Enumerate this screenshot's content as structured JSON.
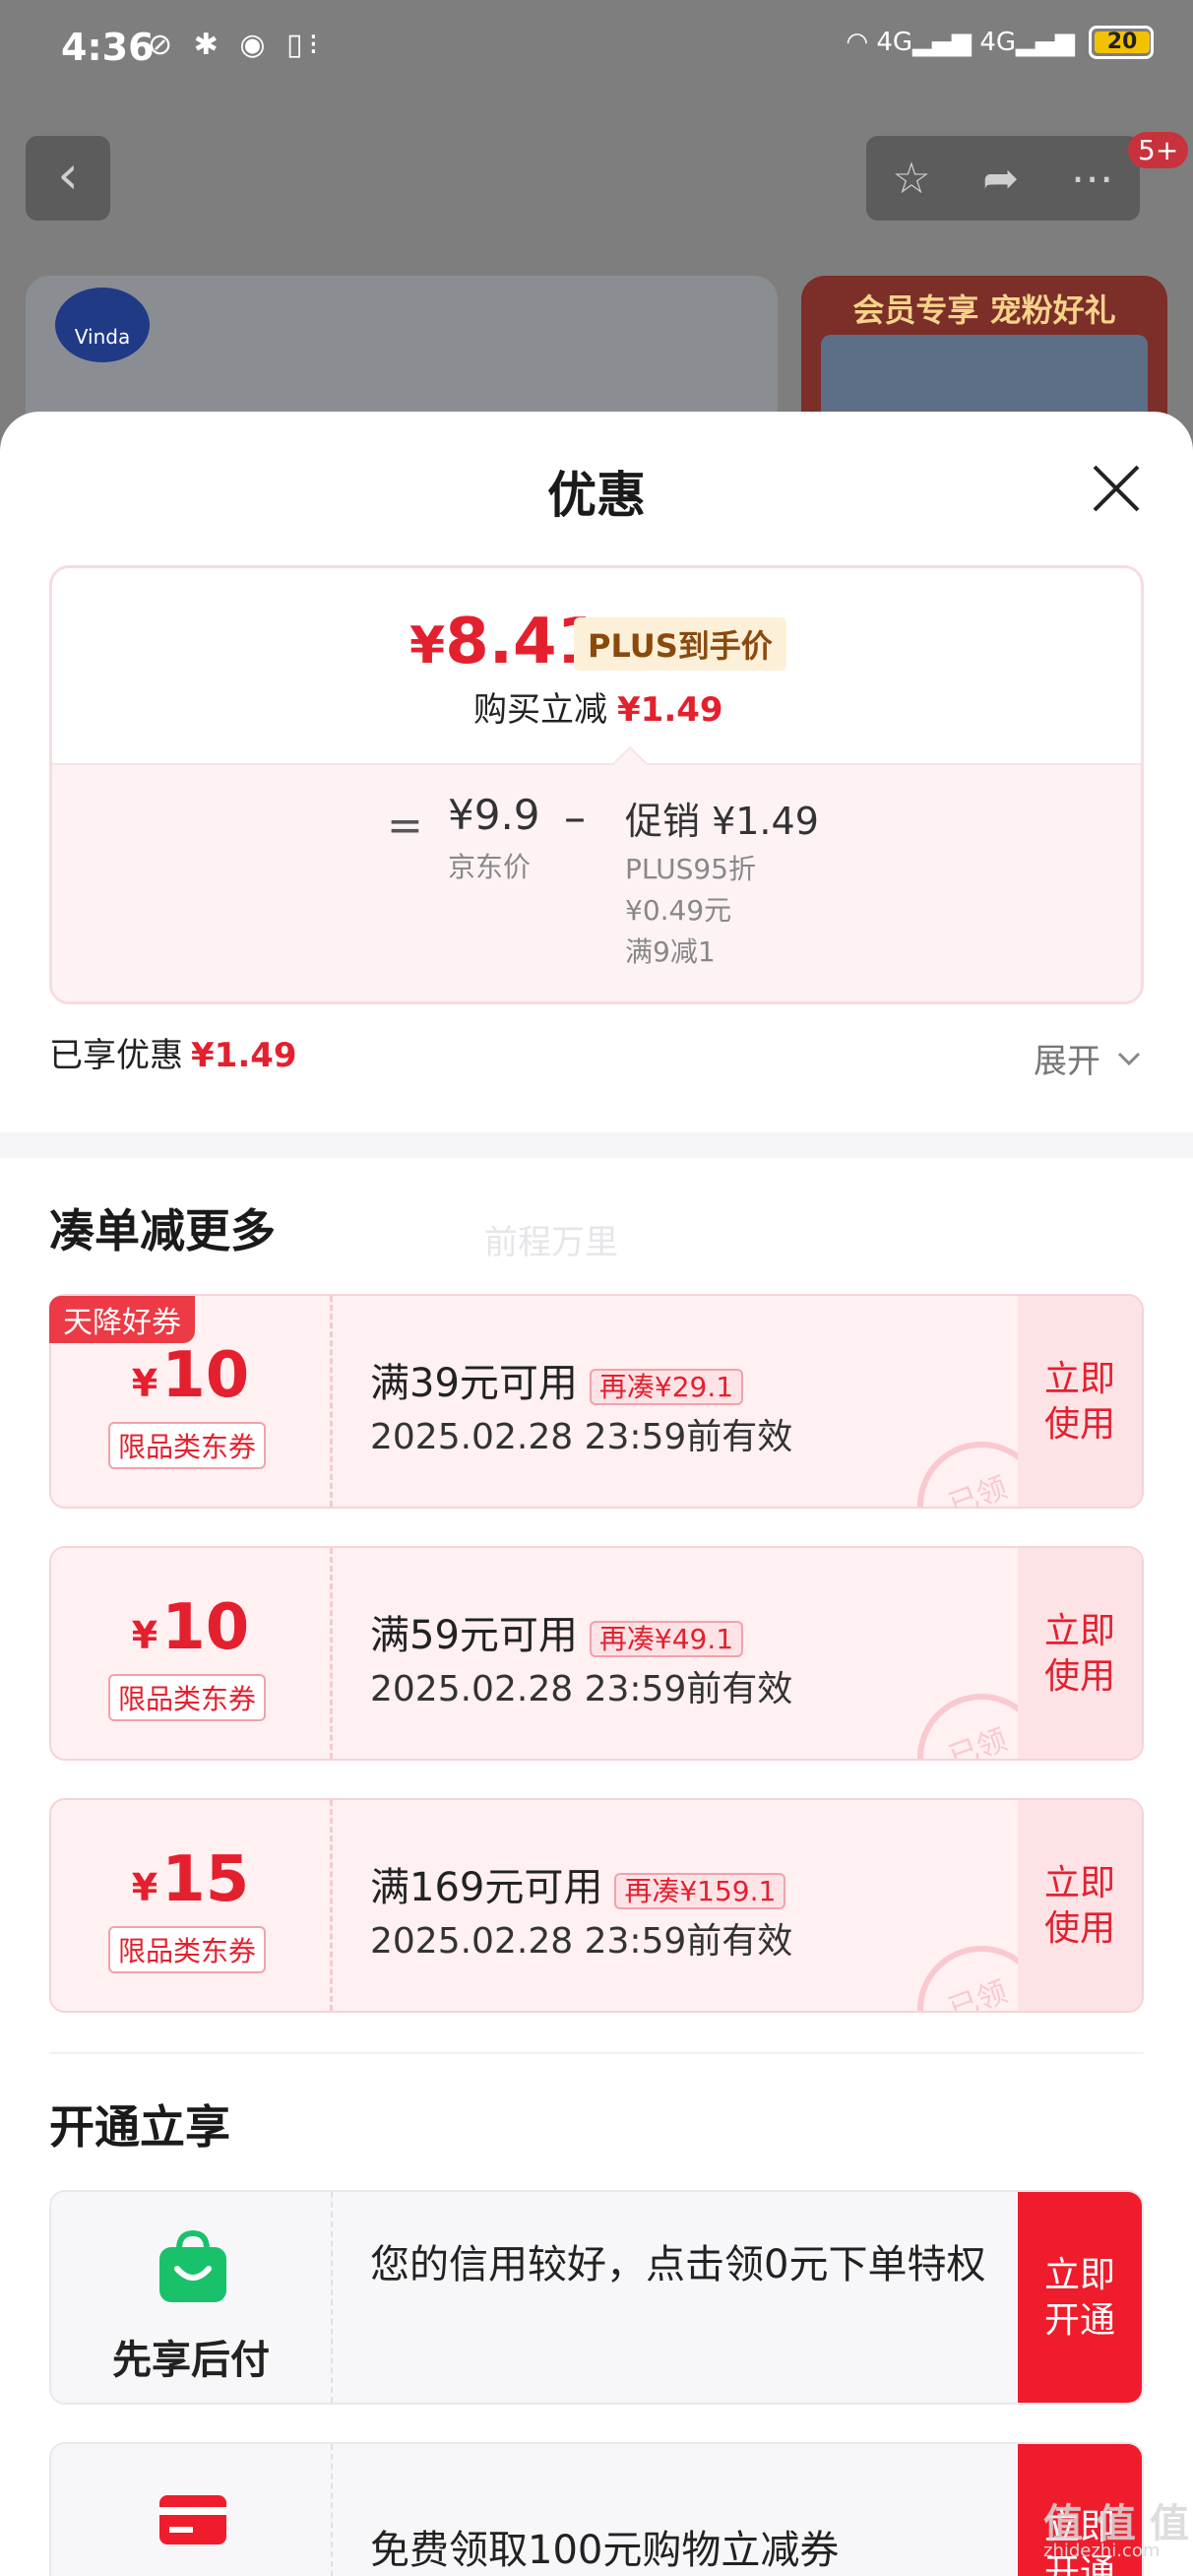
{
  "status_bar": {
    "time": "4:36",
    "battery": "20",
    "left_icons": "⊘ ✱ ◉ ▯⁝",
    "right_icons": "◠ 4G▂▄▆ 4G▂▄▆"
  },
  "top_nav": {
    "back": "‹",
    "more_badge": "5+"
  },
  "bg_cards": {
    "left_logo": "Vinda",
    "right_title": "会员专享 宠粉好礼"
  },
  "sheet": {
    "title": "优惠",
    "summary": {
      "final_price_symbol": "¥",
      "final_price": "8.41",
      "plus_tag": "PLUS到手价",
      "buy_reduce_label": "购买立减",
      "buy_reduce_amount": "¥1.49",
      "eq": "=",
      "jd_price": "¥9.9",
      "jd_label": "京东价",
      "minus": "–",
      "promo": "促销 ¥1.49",
      "promo_lines": [
        "PLUS95折",
        "¥0.49元",
        "满9减1"
      ]
    },
    "enjoyed_label": "已享优惠",
    "enjoyed_amount": "¥1.49",
    "expand_label": "展开",
    "section_more": "凑单减更多",
    "watermark": "前程万里",
    "coupons": [
      {
        "amount": "10",
        "category": "限品类东券",
        "condition": "满39元可用",
        "extra": "再凑¥29.1",
        "date": "2025.02.28 23:59前有效",
        "action_line1": "立即",
        "action_line2": "使用",
        "stamp": "已领",
        "tag": "天降好券"
      },
      {
        "amount": "10",
        "category": "限品类东券",
        "condition": "满59元可用",
        "extra": "再凑¥49.1",
        "date": "2025.02.28 23:59前有效",
        "action_line1": "立即",
        "action_line2": "使用",
        "stamp": "已领"
      },
      {
        "amount": "15",
        "category": "限品类东券",
        "condition": "满169元可用",
        "extra": "再凑¥159.1",
        "date": "2025.02.28 23:59前有效",
        "action_line1": "立即",
        "action_line2": "使用",
        "stamp": "已领"
      }
    ],
    "coupon_currency": "¥",
    "section_open": "开通立享",
    "benefits": [
      {
        "name": "先享后付",
        "desc": "您的信用较好，点击领0元下单特权",
        "action_line1": "立即",
        "action_line2": "开通",
        "icon": "shopping-bag-icon"
      },
      {
        "name": "",
        "desc": "免费领取100元购物立减券",
        "action_line1": "立即",
        "action_line2": "开通",
        "icon": "card-icon"
      }
    ]
  },
  "site_watermark": {
    "main": "值 值 值",
    "sub": "zhidezhi.com"
  },
  "colors": {
    "accent": "#e4202e",
    "action_red": "#ef1c2c",
    "coupon_bg": "#fff0f2",
    "green": "#19c26a"
  }
}
